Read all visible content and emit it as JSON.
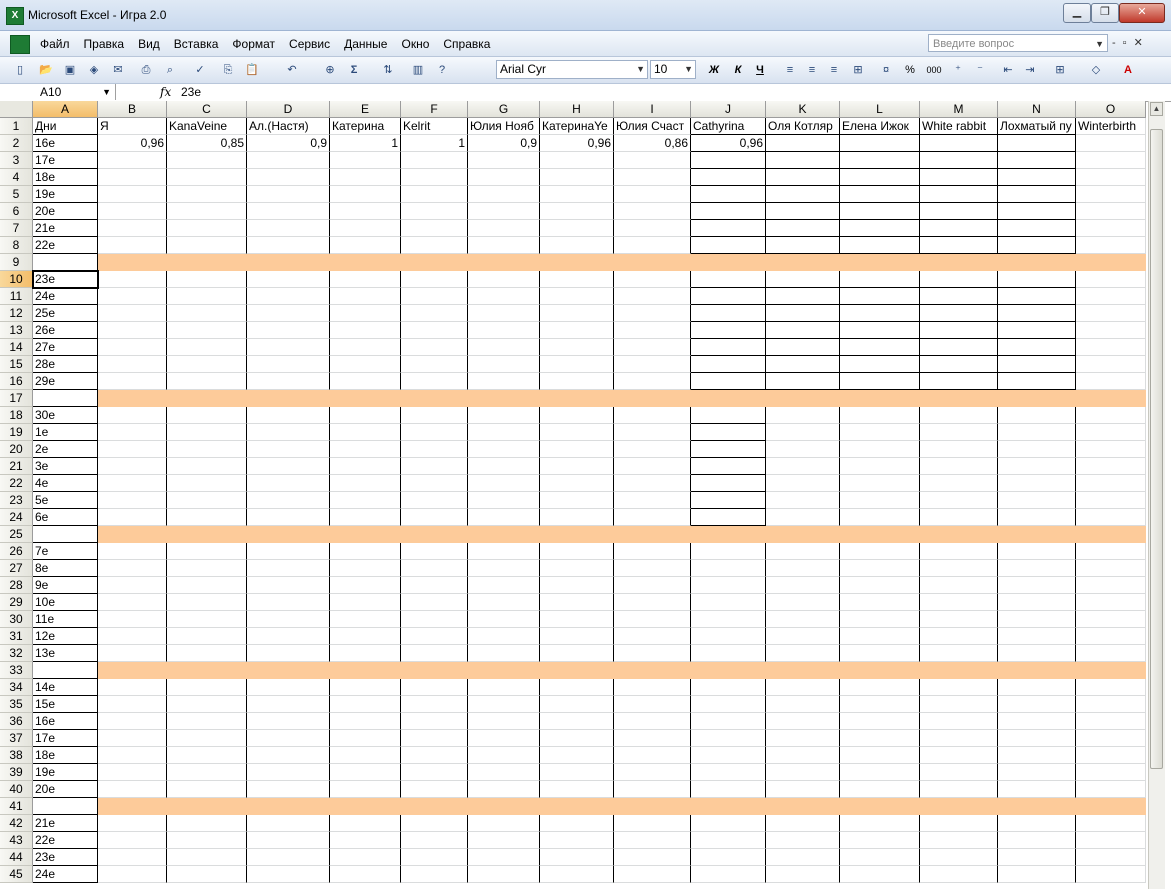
{
  "window": {
    "title": "Microsoft Excel - Игра 2.0",
    "app_icon": "X"
  },
  "menu": [
    "Файл",
    "Правка",
    "Вид",
    "Вставка",
    "Формат",
    "Сервис",
    "Данные",
    "Окно",
    "Справка"
  ],
  "help_placeholder": "Введите вопрос",
  "font": {
    "name": "Arial Cyr",
    "size": "10"
  },
  "toolbar_text": {
    "bold": "Ж",
    "italic": "К",
    "underline": "Ч",
    "percent": "%",
    "thousands": "000",
    "sigma": "Σ"
  },
  "formula": {
    "cell_ref": "A10",
    "fx": "fx",
    "value": "23е"
  },
  "columns": [
    "A",
    "B",
    "C",
    "D",
    "E",
    "F",
    "G",
    "H",
    "I",
    "J",
    "K",
    "L",
    "M",
    "N",
    "O"
  ],
  "header_row": [
    "Дни",
    "Я",
    "KanaVeine",
    "Ал.(Настя)",
    "Катерина",
    "Kelrit",
    "Юлия Нояб",
    "КатеринаYe",
    "Юлия Счаст",
    "Cathyrina",
    "Оля Котляр",
    "Елена Ижок",
    "White rabbit",
    "Лохматый пу",
    "Winterbirth"
  ],
  "row2_values": [
    "16е",
    "0,96",
    "0,85",
    "0,9",
    "1",
    "1",
    "0,9",
    "0,96",
    "0,86",
    "0,96",
    "",
    "",
    "",
    "",
    ""
  ],
  "rows": [
    {
      "n": "1"
    },
    {
      "n": "2"
    },
    {
      "n": "3",
      "a": "17е"
    },
    {
      "n": "4",
      "a": "18е"
    },
    {
      "n": "5",
      "a": "19е"
    },
    {
      "n": "6",
      "a": "20е"
    },
    {
      "n": "7",
      "a": "21е"
    },
    {
      "n": "8",
      "a": "22е"
    },
    {
      "n": "9",
      "sep": true
    },
    {
      "n": "10",
      "a": "23е"
    },
    {
      "n": "11",
      "a": "24е"
    },
    {
      "n": "12",
      "a": "25е"
    },
    {
      "n": "13",
      "a": "26е"
    },
    {
      "n": "14",
      "a": "27е"
    },
    {
      "n": "15",
      "a": "28е"
    },
    {
      "n": "16",
      "a": "29е"
    },
    {
      "n": "17",
      "sep": true
    },
    {
      "n": "18",
      "a": "30е"
    },
    {
      "n": "19",
      "a": "1е"
    },
    {
      "n": "20",
      "a": "2е"
    },
    {
      "n": "21",
      "a": "3е"
    },
    {
      "n": "22",
      "a": "4е"
    },
    {
      "n": "23",
      "a": "5е"
    },
    {
      "n": "24",
      "a": "6е"
    },
    {
      "n": "25",
      "sep": true
    },
    {
      "n": "26",
      "a": "7е"
    },
    {
      "n": "27",
      "a": "8е"
    },
    {
      "n": "28",
      "a": "9е"
    },
    {
      "n": "29",
      "a": "10е"
    },
    {
      "n": "30",
      "a": "11е"
    },
    {
      "n": "31",
      "a": "12е"
    },
    {
      "n": "32",
      "a": "13е"
    },
    {
      "n": "33",
      "sep": true
    },
    {
      "n": "34",
      "a": "14е"
    },
    {
      "n": "35",
      "a": "15е"
    },
    {
      "n": "36",
      "a": "16е"
    },
    {
      "n": "37",
      "a": "17е"
    },
    {
      "n": "38",
      "a": "18е"
    },
    {
      "n": "39",
      "a": "19е"
    },
    {
      "n": "40",
      "a": "20е"
    },
    {
      "n": "41",
      "sep": true
    },
    {
      "n": "42",
      "a": "21е"
    },
    {
      "n": "43",
      "a": "22е"
    },
    {
      "n": "44",
      "a": "23е"
    },
    {
      "n": "45",
      "a": "24е"
    }
  ],
  "colors": {
    "separator": "#fdcb9a",
    "selected_header": "#f3bd6a",
    "excel_green": "#1e7b34"
  }
}
